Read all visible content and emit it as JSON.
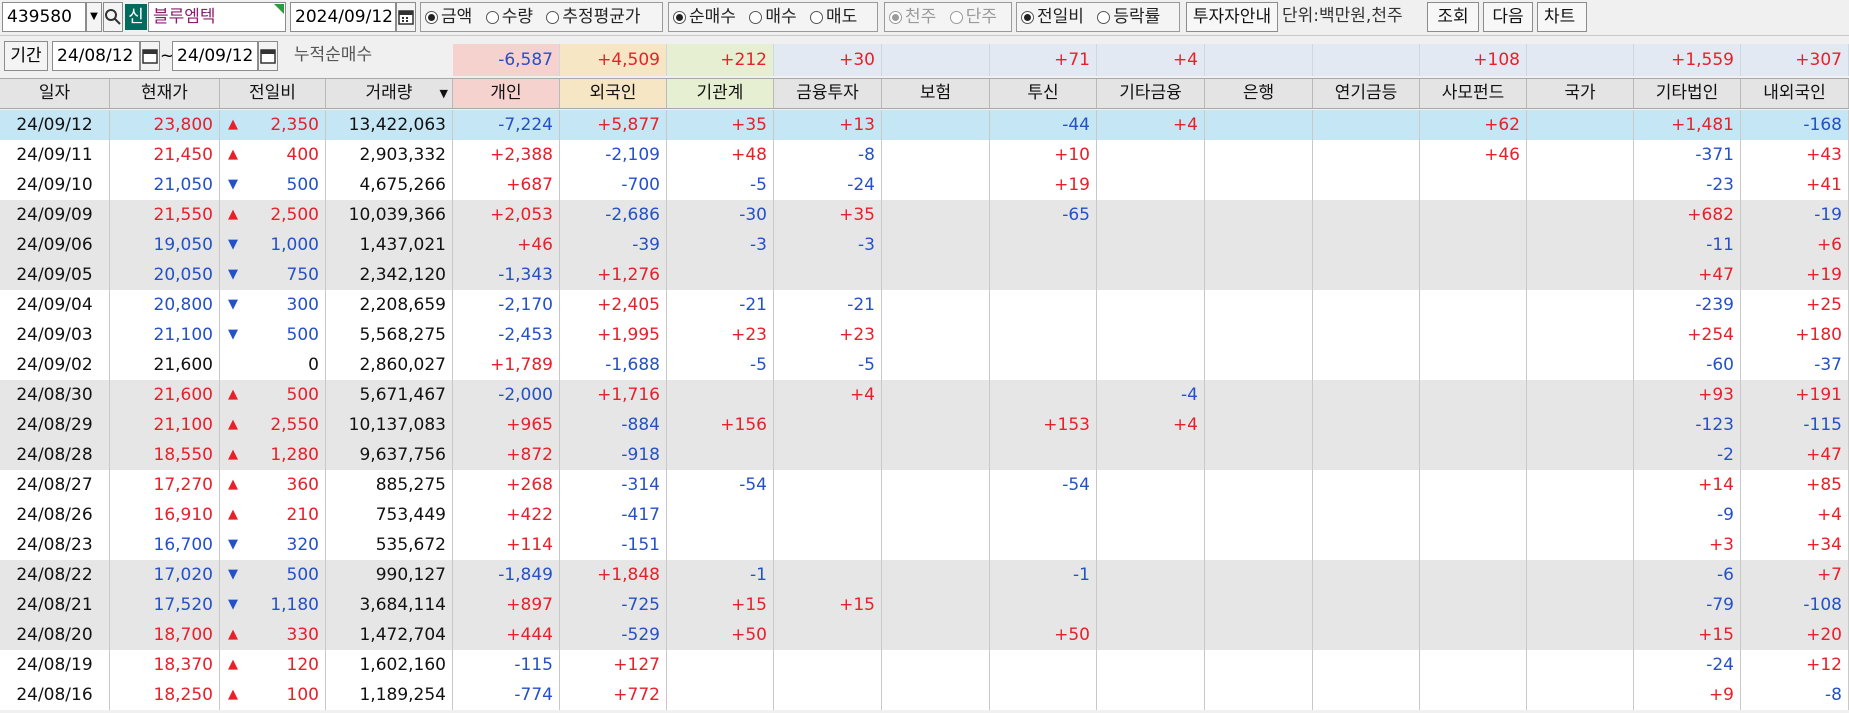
{
  "toolbar": {
    "stock_code": "439580",
    "search_icon": "magnifier-icon",
    "new_badge": "신",
    "stock_name": "블루엠텍",
    "date": "2024/09/12",
    "calendar_icon": "calendar-icon",
    "value_type": {
      "options": [
        "금액",
        "수량",
        "추정평균가"
      ],
      "selected": 0
    },
    "trade_type": {
      "options": [
        "순매수",
        "매수",
        "매도"
      ],
      "selected": 0
    },
    "share_unit": {
      "options": [
        "천주",
        "단주"
      ],
      "selected": 0
    },
    "compare_type": {
      "options": [
        "전일비",
        "등락률"
      ],
      "selected": 0
    },
    "investor_guide_label": "투자자안내",
    "unit_label": "단위:백만원,천주",
    "query_label": "조회",
    "next_label": "다음",
    "chart_label": "차트"
  },
  "period": {
    "label": "기간",
    "start": "24/08/12",
    "sep": "~",
    "end": "24/09/12",
    "cum_label": "누적순매수"
  },
  "summary_values": [
    "-6,587",
    "+4,509",
    "+212",
    "+30",
    "",
    "+71",
    "+4",
    "",
    "",
    "+108",
    "",
    "+1,559",
    "+307"
  ],
  "columns": [
    "일자",
    "현재가",
    "전일비",
    "거래량",
    "개인",
    "외국인",
    "기관계",
    "금융투자",
    "보험",
    "투신",
    "기타금융",
    "은행",
    "연기금등",
    "사모펀드",
    "국가",
    "기타법인",
    "내외국인"
  ],
  "rows": [
    {
      "date": "24/09/12",
      "price": "23,800",
      "dir": "up",
      "chg": "2,350",
      "vol": "13,422,063",
      "vals": [
        "-7,224",
        "+5,877",
        "+35",
        "+13",
        "",
        "-44",
        "+4",
        "",
        "",
        "+62",
        "",
        "+1,481",
        "-168"
      ],
      "selected": true,
      "shade": false
    },
    {
      "date": "24/09/11",
      "price": "21,450",
      "dir": "up",
      "chg": "400",
      "vol": "2,903,332",
      "vals": [
        "+2,388",
        "-2,109",
        "+48",
        "-8",
        "",
        "+10",
        "",
        "",
        "",
        "+46",
        "",
        "-371",
        "+43"
      ],
      "selected": false,
      "shade": false
    },
    {
      "date": "24/09/10",
      "price": "21,050",
      "dir": "down",
      "chg": "500",
      "vol": "4,675,266",
      "vals": [
        "+687",
        "-700",
        "-5",
        "-24",
        "",
        "+19",
        "",
        "",
        "",
        "",
        "",
        "-23",
        "+41"
      ],
      "selected": false,
      "shade": false
    },
    {
      "date": "24/09/09",
      "price": "21,550",
      "dir": "up",
      "chg": "2,500",
      "vol": "10,039,366",
      "vals": [
        "+2,053",
        "-2,686",
        "-30",
        "+35",
        "",
        "-65",
        "",
        "",
        "",
        "",
        "",
        "+682",
        "-19"
      ],
      "selected": false,
      "shade": true
    },
    {
      "date": "24/09/06",
      "price": "19,050",
      "dir": "down",
      "chg": "1,000",
      "vol": "1,437,021",
      "vals": [
        "+46",
        "-39",
        "-3",
        "-3",
        "",
        "",
        "",
        "",
        "",
        "",
        "",
        "-11",
        "+6"
      ],
      "selected": false,
      "shade": true
    },
    {
      "date": "24/09/05",
      "price": "20,050",
      "dir": "down",
      "chg": "750",
      "vol": "2,342,120",
      "vals": [
        "-1,343",
        "+1,276",
        "",
        "",
        "",
        "",
        "",
        "",
        "",
        "",
        "",
        "+47",
        "+19"
      ],
      "selected": false,
      "shade": true
    },
    {
      "date": "24/09/04",
      "price": "20,800",
      "dir": "down",
      "chg": "300",
      "vol": "2,208,659",
      "vals": [
        "-2,170",
        "+2,405",
        "-21",
        "-21",
        "",
        "",
        "",
        "",
        "",
        "",
        "",
        "-239",
        "+25"
      ],
      "selected": false,
      "shade": false
    },
    {
      "date": "24/09/03",
      "price": "21,100",
      "dir": "down",
      "chg": "500",
      "vol": "5,568,275",
      "vals": [
        "-2,453",
        "+1,995",
        "+23",
        "+23",
        "",
        "",
        "",
        "",
        "",
        "",
        "",
        "+254",
        "+180"
      ],
      "selected": false,
      "shade": false
    },
    {
      "date": "24/09/02",
      "price": "21,600",
      "dir": "none",
      "chg": "0",
      "vol": "2,860,027",
      "vals": [
        "+1,789",
        "-1,688",
        "-5",
        "-5",
        "",
        "",
        "",
        "",
        "",
        "",
        "",
        "-60",
        "-37"
      ],
      "selected": false,
      "shade": false
    },
    {
      "date": "24/08/30",
      "price": "21,600",
      "dir": "up",
      "chg": "500",
      "vol": "5,671,467",
      "vals": [
        "-2,000",
        "+1,716",
        "",
        "+4",
        "",
        "",
        "-4",
        "",
        "",
        "",
        "",
        "+93",
        "+191"
      ],
      "selected": false,
      "shade": true
    },
    {
      "date": "24/08/29",
      "price": "21,100",
      "dir": "up",
      "chg": "2,550",
      "vol": "10,137,083",
      "vals": [
        "+965",
        "-884",
        "+156",
        "",
        "",
        "+153",
        "+4",
        "",
        "",
        "",
        "",
        "-123",
        "-115"
      ],
      "selected": false,
      "shade": true
    },
    {
      "date": "24/08/28",
      "price": "18,550",
      "dir": "up",
      "chg": "1,280",
      "vol": "9,637,756",
      "vals": [
        "+872",
        "-918",
        "",
        "",
        "",
        "",
        "",
        "",
        "",
        "",
        "",
        "-2",
        "+47"
      ],
      "selected": false,
      "shade": true
    },
    {
      "date": "24/08/27",
      "price": "17,270",
      "dir": "up",
      "chg": "360",
      "vol": "885,275",
      "vals": [
        "+268",
        "-314",
        "-54",
        "",
        "",
        "-54",
        "",
        "",
        "",
        "",
        "",
        "+14",
        "+85"
      ],
      "selected": false,
      "shade": false
    },
    {
      "date": "24/08/26",
      "price": "16,910",
      "dir": "up",
      "chg": "210",
      "vol": "753,449",
      "vals": [
        "+422",
        "-417",
        "",
        "",
        "",
        "",
        "",
        "",
        "",
        "",
        "",
        "-9",
        "+4"
      ],
      "selected": false,
      "shade": false
    },
    {
      "date": "24/08/23",
      "price": "16,700",
      "dir": "down",
      "chg": "320",
      "vol": "535,672",
      "vals": [
        "+114",
        "-151",
        "",
        "",
        "",
        "",
        "",
        "",
        "",
        "",
        "",
        "+3",
        "+34"
      ],
      "selected": false,
      "shade": false
    },
    {
      "date": "24/08/22",
      "price": "17,020",
      "dir": "down",
      "chg": "500",
      "vol": "990,127",
      "vals": [
        "-1,849",
        "+1,848",
        "-1",
        "",
        "",
        "-1",
        "",
        "",
        "",
        "",
        "",
        "-6",
        "+7"
      ],
      "selected": false,
      "shade": true
    },
    {
      "date": "24/08/21",
      "price": "17,520",
      "dir": "down",
      "chg": "1,180",
      "vol": "3,684,114",
      "vals": [
        "+897",
        "-725",
        "+15",
        "+15",
        "",
        "",
        "",
        "",
        "",
        "",
        "",
        "-79",
        "-108"
      ],
      "selected": false,
      "shade": true
    },
    {
      "date": "24/08/20",
      "price": "18,700",
      "dir": "up",
      "chg": "330",
      "vol": "1,472,704",
      "vals": [
        "+444",
        "-529",
        "+50",
        "",
        "",
        "+50",
        "",
        "",
        "",
        "",
        "",
        "+15",
        "+20"
      ],
      "selected": false,
      "shade": true
    },
    {
      "date": "24/08/19",
      "price": "18,370",
      "dir": "up",
      "chg": "120",
      "vol": "1,602,160",
      "vals": [
        "-115",
        "+127",
        "",
        "",
        "",
        "",
        "",
        "",
        "",
        "",
        "",
        "-24",
        "+12"
      ],
      "selected": false,
      "shade": false
    },
    {
      "date": "24/08/16",
      "price": "18,250",
      "dir": "up",
      "chg": "100",
      "vol": "1,189,254",
      "vals": [
        "-774",
        "+772",
        "",
        "",
        "",
        "",
        "",
        "",
        "",
        "",
        "",
        "+9",
        "-8"
      ],
      "selected": false,
      "shade": false
    }
  ],
  "colors": {
    "up": "#e8202a",
    "down": "#2451c6",
    "neutral": "#111111",
    "selected_row": "#c5e6f5",
    "shaded_row": "#e6e6e6",
    "white_row": "#ffffff",
    "badge": "#006c5e",
    "summary_individual": "#f6d2cf",
    "summary_foreign": "#f6e6c4",
    "summary_institution": "#e6efd2",
    "summary_rest": "#e3e9f3"
  }
}
